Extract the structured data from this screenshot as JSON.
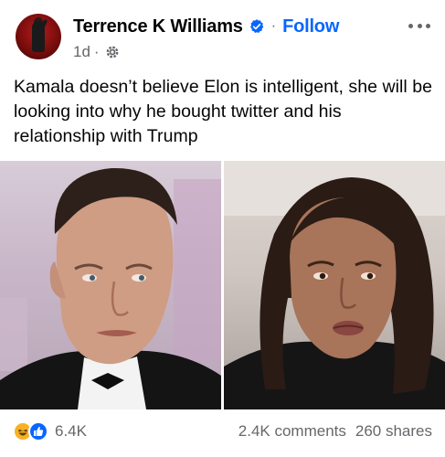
{
  "post": {
    "author": {
      "name": "Terrence K Williams",
      "verified": true,
      "follow_label": "Follow",
      "separator": "·"
    },
    "meta": {
      "time": "1d",
      "separator": "·",
      "audience_icon": "gear-icon"
    },
    "text": "Kamala doesn’t believe Elon is intelligent, she will be looking into why he bought twitter and his relationship with Trump",
    "photos": [
      {
        "icon": "photo-left-man"
      },
      {
        "icon": "photo-right-woman"
      }
    ],
    "reactions": {
      "icons": [
        "haha-icon",
        "like-icon"
      ],
      "count": "6.4K"
    },
    "stats": {
      "comments": "2.4K comments",
      "shares": "260 shares"
    }
  },
  "colors": {
    "link_blue": "#0866ff",
    "secondary_text": "#65676b",
    "primary_text": "#050505"
  }
}
